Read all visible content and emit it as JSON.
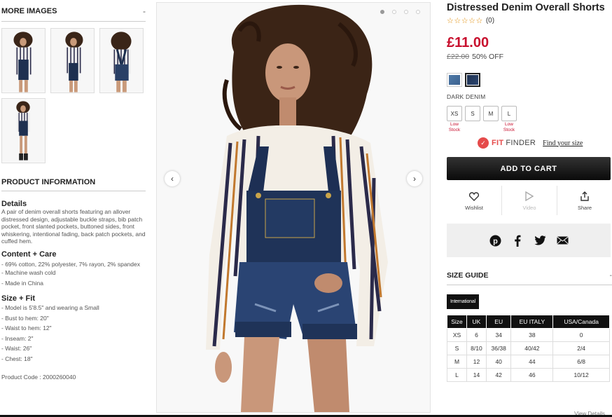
{
  "more_images": {
    "heading": "MORE IMAGES",
    "toggle": "-"
  },
  "product_info": {
    "heading": "PRODUCT INFORMATION",
    "toggle": "",
    "details_title": "Details",
    "details_text": "A pair of denim overall shorts featuring an allover distressed design, adjustable buckle straps, bib patch pocket, front slanted pockets, buttoned sides, front whiskering, intentional fading, back patch pockets, and cuffed hem.",
    "content_title": "Content + Care",
    "content_items": [
      "- 69% cotton, 22% polyester, 7% rayon, 2% spandex",
      "- Machine wash cold",
      "- Made in China"
    ],
    "fit_title": "Size + Fit",
    "fit_items": [
      "- Model is 5'8.5\" and wearing a Small",
      "- Bust to hem: 20\"",
      "- Waist to hem: 12\"",
      "- Inseam: 2\"",
      "- Waist: 26\"",
      "- Chest: 18\""
    ],
    "product_code": "Product Code : 2000260040"
  },
  "product": {
    "title": "Distressed Denim Overall Shorts",
    "stars": "☆☆☆☆☆",
    "review_count": "(0)",
    "price": "£11.00",
    "old_price": "£22.00",
    "discount": "50% OFF",
    "color_name": "DARK DENIM",
    "swatch_colors": [
      "#4f7aa8",
      "#1e3050"
    ],
    "sizes": [
      {
        "label": "XS",
        "low_stock": "Low Stock"
      },
      {
        "label": "S",
        "low_stock": ""
      },
      {
        "label": "M",
        "low_stock": ""
      },
      {
        "label": "L",
        "low_stock": "Low Stock"
      }
    ],
    "fit_finder_a": "FIT",
    "fit_finder_b": "FINDER",
    "find_size": "Find your size",
    "add_to_cart": "ADD TO CART",
    "actions": [
      {
        "label": "Wishlist",
        "icon": "heart-icon"
      },
      {
        "label": "Video",
        "icon": "play-icon"
      },
      {
        "label": "Share",
        "icon": "share-icon"
      }
    ],
    "social": [
      "pinterest-icon",
      "facebook-icon",
      "twitter-icon",
      "email-icon"
    ]
  },
  "size_guide": {
    "heading": "SIZE GUIDE",
    "toggle": "-",
    "region_tab": "International",
    "columns": [
      "Size",
      "UK",
      "EU",
      "EU ITALY",
      "USA/Canada"
    ],
    "rows": [
      [
        "XS",
        "6",
        "34",
        "38",
        "0"
      ],
      [
        "S",
        "8/10",
        "36/38",
        "40/42",
        "2/4"
      ],
      [
        "M",
        "12",
        "40",
        "44",
        "6/8"
      ],
      [
        "L",
        "14",
        "42",
        "46",
        "10/12"
      ]
    ],
    "view_details": "View Details"
  },
  "gallery": {
    "dots": 4,
    "active_dot": 0,
    "prev": "‹",
    "next": "›"
  },
  "colors": {
    "price_red": "#c8102e",
    "fit_red": "#e54b4b",
    "button_dark": "#111111"
  }
}
